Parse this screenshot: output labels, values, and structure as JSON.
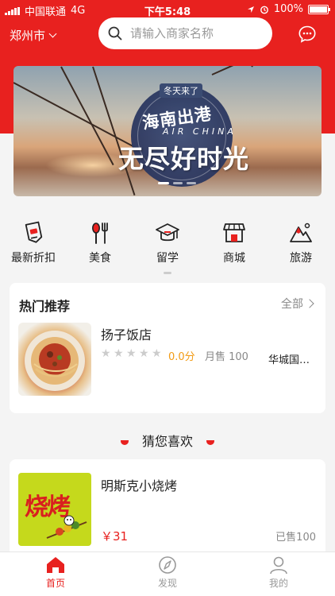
{
  "status_bar": {
    "carrier": "中国联通",
    "network": "4G",
    "time": "下午5:48",
    "battery": "100%",
    "battery_level": 1.0
  },
  "header": {
    "city": "郑州市",
    "search_placeholder": "请输入商家名称"
  },
  "banner": {
    "tag": "冬天来了",
    "headline": "海南出港",
    "airline": "AIR CHINA",
    "slogan": "无尽好时光"
  },
  "categories": [
    {
      "label": "最新折扣",
      "icon": "discount-tag-icon"
    },
    {
      "label": "美食",
      "icon": "fork-spoon-icon"
    },
    {
      "label": "留学",
      "icon": "graduation-cap-icon"
    },
    {
      "label": "商城",
      "icon": "shop-icon"
    },
    {
      "label": "旅游",
      "icon": "mountain-icon"
    }
  ],
  "hot": {
    "title": "热门推荐",
    "all_label": "全部",
    "item": {
      "name": "扬子饭店",
      "rating": 0,
      "score": "0.0分",
      "sold": "月售 100",
      "location": "华城国际中心"
    }
  },
  "guess": {
    "title": "猜您喜欢"
  },
  "list": [
    {
      "name": "明斯克小烧烤",
      "thumb_text": "烧烤",
      "price": "￥31",
      "sold": "已售100"
    }
  ],
  "tabs": [
    {
      "label": "首页",
      "icon": "home-icon",
      "active": true
    },
    {
      "label": "发现",
      "icon": "compass-icon",
      "active": false
    },
    {
      "label": "我的",
      "icon": "user-icon",
      "active": false
    }
  ],
  "colors": {
    "brand": "#e8211f",
    "score": "#f29b14",
    "muted": "#888888"
  }
}
